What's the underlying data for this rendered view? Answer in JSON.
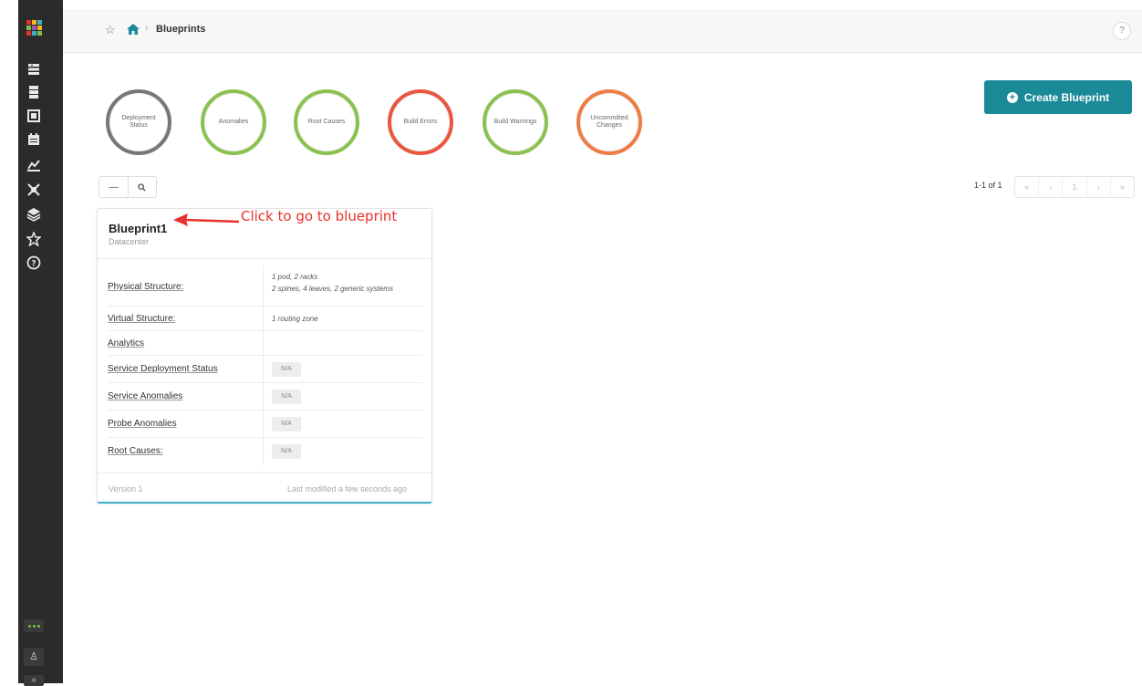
{
  "sidebar": {
    "logo_colors": [
      "#e8312b",
      "#f7b81c",
      "#3cb0c8",
      "#7bc043",
      "#9b59b6",
      "#f7b81c",
      "#e8312b",
      "#3cb0c8",
      "#7bc043"
    ],
    "items": [
      {
        "icon": "blueprints-icon"
      },
      {
        "icon": "devices-icon"
      },
      {
        "icon": "design-icon"
      },
      {
        "icon": "resources-icon"
      },
      {
        "icon": "analytics-icon"
      },
      {
        "icon": "external-systems-icon"
      },
      {
        "icon": "platform-icon"
      },
      {
        "icon": "favorites-icon"
      },
      {
        "icon": "help-icon"
      }
    ],
    "user_glyph": "♙",
    "collapse_glyph": "»"
  },
  "header": {
    "star_glyph": "☆",
    "separator": "›",
    "title": "Blueprints",
    "help_label": "?"
  },
  "status_circles": [
    {
      "label": "Deployment Status",
      "color": "#777777"
    },
    {
      "label": "Anomalies",
      "color": "#8cc152"
    },
    {
      "label": "Root Causes",
      "color": "#8cc152"
    },
    {
      "label": "Build Errors",
      "color": "#e9573f"
    },
    {
      "label": "Build Warnings",
      "color": "#8cc152"
    },
    {
      "label": "Uncommitted Changes",
      "color": "#ee7d45"
    }
  ],
  "actions": {
    "create_label": "Create Blueprint",
    "create_glyph": "+",
    "collapse_glyph": "—",
    "search_glyph": "🔍"
  },
  "pagination": {
    "summary": "1-1 of 1",
    "first": "«",
    "prev": "‹",
    "page": "1",
    "next": "›",
    "last": "»"
  },
  "blueprint": {
    "name": "Blueprint1",
    "type": "Datacenter",
    "physical_label": "Physical Structure:",
    "physical_line1": "1 pod, 2 racks",
    "physical_line2": "2 spines, 4 leaves, 2 generic systems",
    "virtual_label": "Virtual Structure:",
    "virtual_value": "1 routing zone",
    "analytics_label": "Analytics",
    "service_deploy_label": "Service Deployment Status",
    "service_anom_label": "Service Anomalies",
    "probe_anom_label": "Probe Anomalies",
    "root_causes_label": "Root Causes:",
    "na": "N/A",
    "version": "Version 1",
    "modified": "Last modified a few seconds ago"
  },
  "annotation": {
    "text": "Click to go to blueprint",
    "color": "#e8312b"
  }
}
